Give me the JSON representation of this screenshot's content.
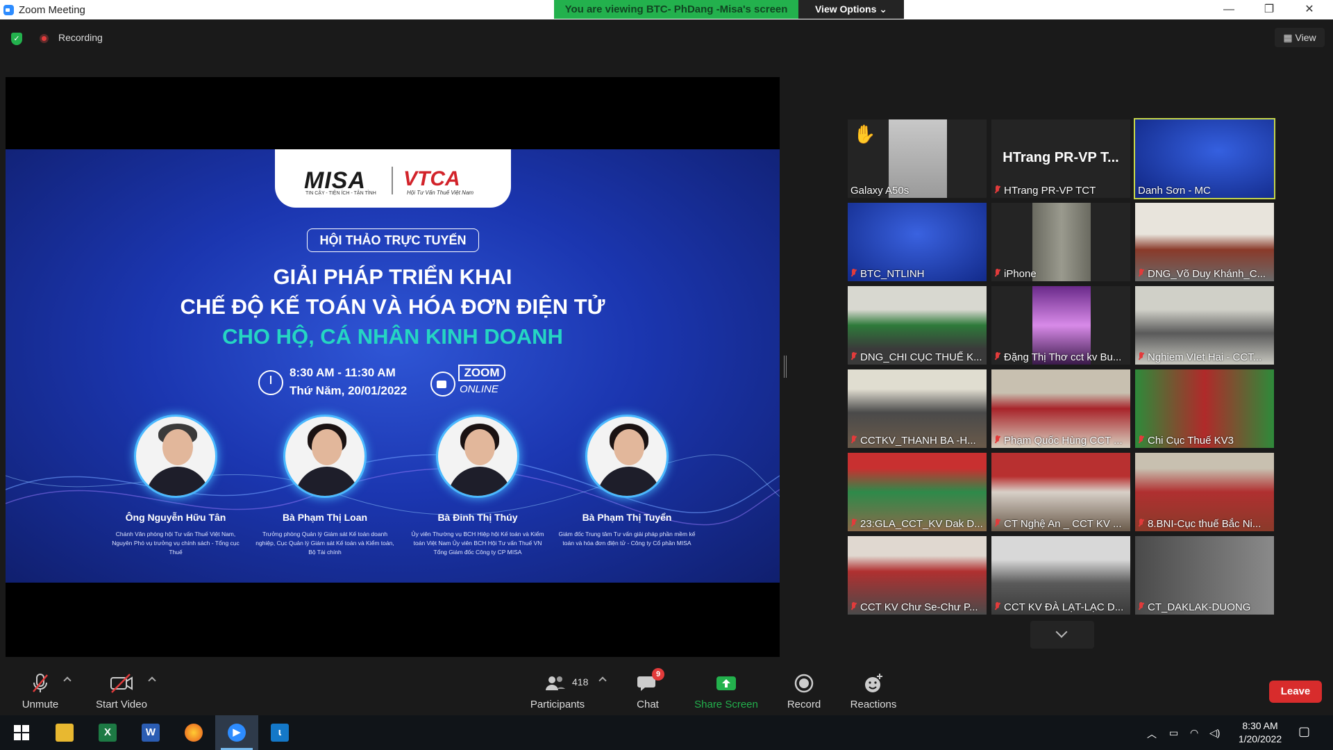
{
  "window": {
    "title": "Zoom Meeting",
    "viewing_banner": "You are viewing BTC- PhDang -Misa's screen",
    "view_options": "View Options"
  },
  "topbar": {
    "recording": "Recording",
    "view": "View"
  },
  "slide": {
    "logo_left": "MISA",
    "logo_left_tagline": "TIN CẬY - TIỆN ÍCH - TẬN TÌNH",
    "logo_right": "VTCA",
    "logo_right_tagline": "Hội Tư Vấn Thuế Việt Nam",
    "kicker": "HỘI THẢO TRỰC TUYẾN",
    "title_line1": "GIẢI PHÁP TRIỂN KHAI",
    "title_line2": "CHẾ ĐỘ KẾ TOÁN VÀ HÓA ĐƠN ĐIỆN TỬ",
    "title_line3": "CHO HỘ, CÁ NHÂN KINH DOANH",
    "time": "8:30 AM - 11:30 AM",
    "date": "Thứ Năm, 20/01/2022",
    "zoom_label": "ZOOM",
    "zoom_sub": "ONLINE",
    "speakers": [
      {
        "name": "Ông Nguyễn Hữu Tân",
        "desc": "Chánh Văn phòng hội Tư vấn Thuế Việt Nam, Nguyên Phó vụ trưởng vụ chính sách - Tổng cục Thuế"
      },
      {
        "name": "Bà Phạm Thị Loan",
        "desc": "Trưởng phòng Quản lý Giám sát Kế toán doanh nghiệp, Cục Quản lý Giám sát Kế toán và Kiểm toán, Bộ Tài chính"
      },
      {
        "name": "Bà Đinh Thị Thúy",
        "desc": "Ủy viên Thường vụ BCH Hiệp hội Kế toán và Kiểm toán Việt Nam Ủy viên BCH Hội Tư vấn Thuế VN Tổng Giám đốc Công ty CP MISA"
      },
      {
        "name": "Bà Phạm Thị Tuyển",
        "desc": "Giám đốc Trung tâm Tư vấn giải pháp phần mềm kế toán và hóa đơn điện tử - Công ty Cổ phần MISA"
      }
    ]
  },
  "participants_grid": [
    {
      "name": "Galaxy A50s",
      "muted": false
    },
    {
      "name": "HTrang PR-VP TCT",
      "big_name": "HTrang PR-VP T...",
      "muted": true
    },
    {
      "name": "Danh Sơn - MC",
      "muted": false
    },
    {
      "name": "BTC_NTLINH",
      "muted": true
    },
    {
      "name": "iPhone",
      "muted": true
    },
    {
      "name": "DNG_Võ Duy Khánh_C...",
      "muted": true
    },
    {
      "name": "DNG_CHI CỤC THUẾ K...",
      "muted": true
    },
    {
      "name": "Đặng Thị Thơ cct kv Bu...",
      "muted": true
    },
    {
      "name": "Nghiem VIet Hai - CCT...",
      "muted": true
    },
    {
      "name": "CCTKV_THANH BA -H...",
      "muted": true
    },
    {
      "name": "Phạm Quốc Hùng CCT ...",
      "muted": true
    },
    {
      "name": "Chi Cục Thuế KV3",
      "muted": true
    },
    {
      "name": "23:GLA_CCT_KV Dak D...",
      "muted": true
    },
    {
      "name": "CT Nghệ An _ CCT KV ...",
      "muted": true
    },
    {
      "name": "8.BNI-Cục thuế Bắc Ni...",
      "muted": true
    },
    {
      "name": "CCT KV Chư Se-Chư P...",
      "muted": true
    },
    {
      "name": "CCT KV ĐÀ LẠT-LẠC D...",
      "muted": true
    },
    {
      "name": "CT_DAKLAK-DUONG",
      "muted": true
    }
  ],
  "toolbar": {
    "unmute": "Unmute",
    "start_video": "Start Video",
    "participants_count": "418",
    "participants": "Participants",
    "chat_badge": "9",
    "chat": "Chat",
    "share_screen": "Share Screen",
    "record": "Record",
    "reactions": "Reactions",
    "leave": "Leave"
  },
  "taskbar": {
    "time": "8:30 AM",
    "date": "1/20/2022"
  },
  "colors": {
    "zoom_blue": "#2d8cff",
    "green": "#23b14d",
    "leave_red": "#d82c2c",
    "active_border": "#c6d64a"
  }
}
